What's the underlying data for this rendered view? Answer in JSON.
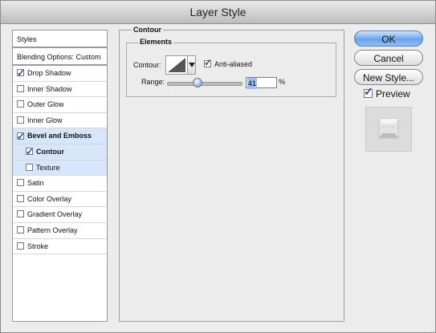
{
  "window": {
    "title": "Layer Style"
  },
  "sidebar": {
    "header": "Styles",
    "blending": "Blending Options: Custom",
    "items": [
      {
        "label": "Drop Shadow",
        "checked": true,
        "selected": false,
        "bold": false,
        "sub": false
      },
      {
        "label": "Inner Shadow",
        "checked": false,
        "selected": false,
        "bold": false,
        "sub": false
      },
      {
        "label": "Outer Glow",
        "checked": false,
        "selected": false,
        "bold": false,
        "sub": false
      },
      {
        "label": "Inner Glow",
        "checked": false,
        "selected": false,
        "bold": false,
        "sub": false
      },
      {
        "label": "Bevel and Emboss",
        "checked": true,
        "selected": true,
        "bold": true,
        "sub": false
      },
      {
        "label": "Contour",
        "checked": true,
        "selected": true,
        "bold": true,
        "sub": true
      },
      {
        "label": "Texture",
        "checked": false,
        "selected": true,
        "bold": false,
        "sub": true
      },
      {
        "label": "Satin",
        "checked": false,
        "selected": false,
        "bold": false,
        "sub": false
      },
      {
        "label": "Color Overlay",
        "checked": false,
        "selected": false,
        "bold": false,
        "sub": false
      },
      {
        "label": "Gradient Overlay",
        "checked": false,
        "selected": false,
        "bold": false,
        "sub": false
      },
      {
        "label": "Pattern Overlay",
        "checked": false,
        "selected": false,
        "bold": false,
        "sub": false
      },
      {
        "label": "Stroke",
        "checked": false,
        "selected": false,
        "bold": false,
        "sub": false
      }
    ]
  },
  "panel": {
    "section_title": "Contour",
    "group_title": "Elements",
    "contour_label": "Contour:",
    "anti_aliased_label": "Anti-aliased",
    "anti_aliased": true,
    "range_label": "Range:",
    "range_value": "41",
    "range_fraction": 0.41,
    "percent": "%"
  },
  "buttons": {
    "ok": "OK",
    "cancel": "Cancel",
    "new_style": "New Style..."
  },
  "preview": {
    "label": "Preview",
    "checked": true
  },
  "colors": {
    "selection": "#d7e6fb",
    "ok_button": "#6aa4ec"
  }
}
